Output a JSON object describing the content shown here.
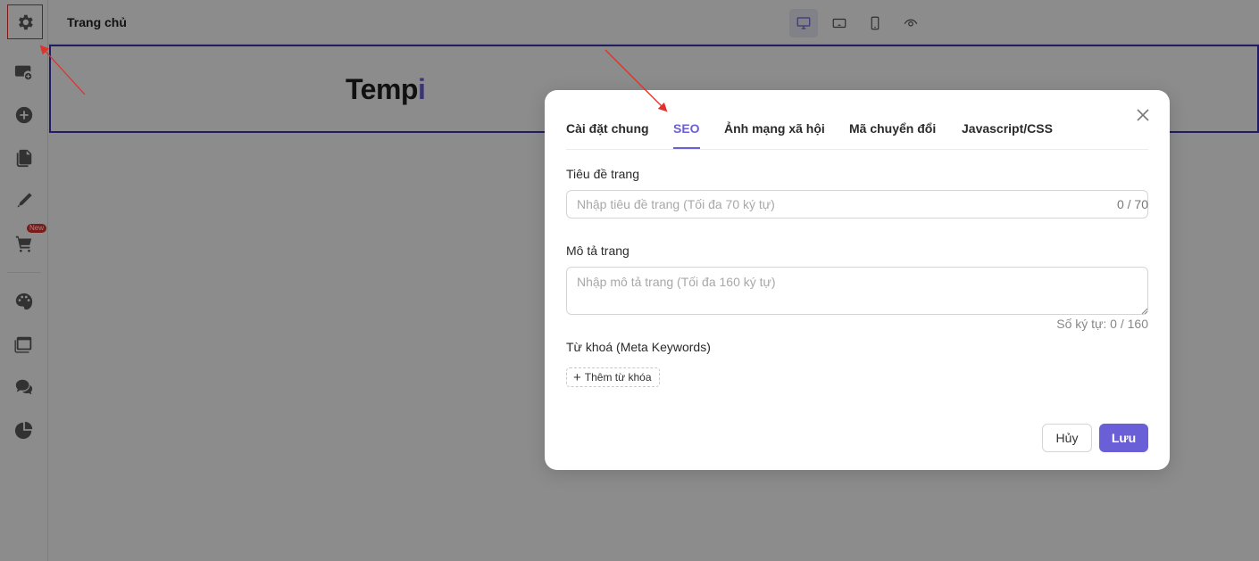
{
  "topbar": {
    "title": "Trang chủ",
    "views": [
      {
        "icon": "desktop-icon",
        "active": true
      },
      {
        "icon": "tablet-icon",
        "active": false
      },
      {
        "icon": "mobile-icon",
        "active": false
      },
      {
        "icon": "preview-eye-icon",
        "active": false
      }
    ]
  },
  "sidebar": {
    "items": [
      {
        "icon": "gear-icon"
      },
      {
        "icon": "add-section-icon"
      },
      {
        "icon": "add-element-icon"
      },
      {
        "icon": "pages-icon"
      },
      {
        "icon": "pen-icon"
      },
      {
        "icon": "cart-icon",
        "badge": "New"
      },
      {
        "icon": "palette-icon"
      },
      {
        "icon": "layers-icon"
      },
      {
        "icon": "chat-icon"
      },
      {
        "icon": "pie-chart-icon"
      }
    ]
  },
  "canvas": {
    "logo_main": "Temp",
    "logo_accent": "i"
  },
  "modal": {
    "tabs": [
      {
        "label": "Cài đặt chung",
        "active": false
      },
      {
        "label": "SEO",
        "active": true
      },
      {
        "label": "Ảnh mạng xã hội",
        "active": false
      },
      {
        "label": "Mã chuyển đổi",
        "active": false
      },
      {
        "label": "Javascript/CSS",
        "active": false
      }
    ],
    "page_title_label": "Tiêu đề trang",
    "page_title_value": "",
    "page_title_placeholder": "Nhập tiêu đề trang (Tối đa 70 ký tự)",
    "page_title_counter": "0 / 70",
    "description_label": "Mô tả trang",
    "description_value": "",
    "description_placeholder": "Nhập mô tả trang (Tối đa 160 ký tự)",
    "description_counter": "Số ký tự: 0 / 160",
    "keywords_label": "Từ khoá (Meta Keywords)",
    "add_keyword_label": "Thêm từ khóa",
    "cancel_label": "Hủy",
    "save_label": "Lưu"
  },
  "colors": {
    "accent": "#6b5fd7",
    "annotation_red": "#e0312b",
    "header_outline": "#3f33b5"
  }
}
